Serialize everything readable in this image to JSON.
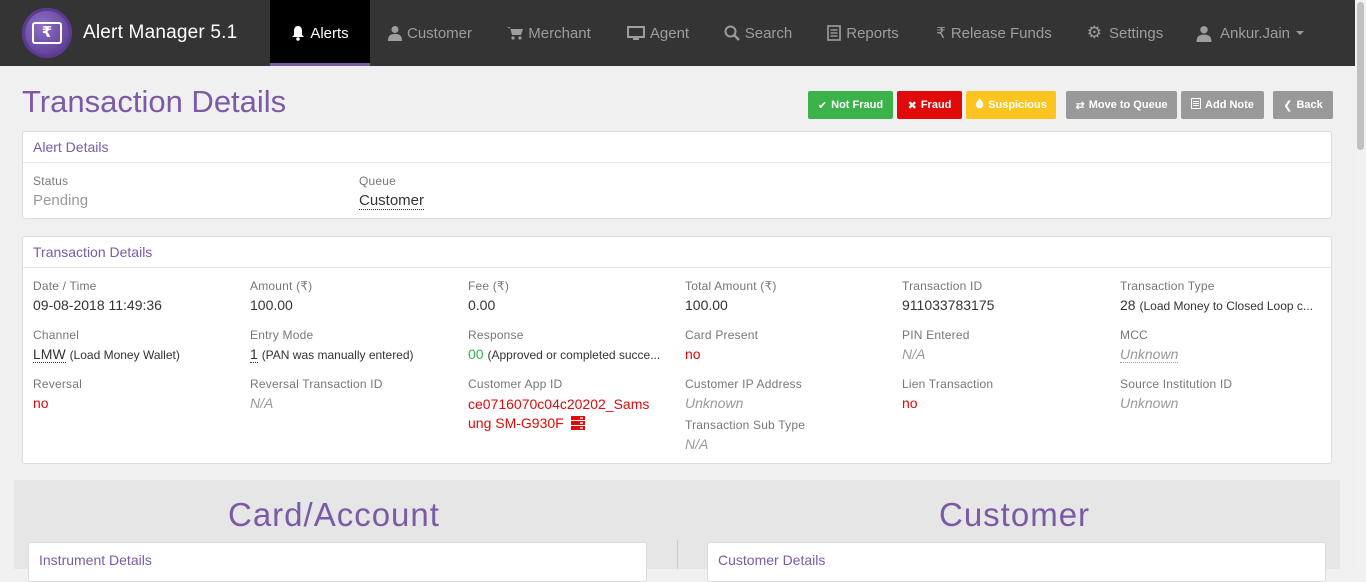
{
  "app": {
    "title": "Alert Manager 5.1",
    "logo_symbol": "₹"
  },
  "nav": {
    "items": [
      {
        "label": "Alerts",
        "icon": "bell-icon",
        "active": true
      },
      {
        "label": "Customer",
        "icon": "user-icon"
      },
      {
        "label": "Merchant",
        "icon": "cart-icon"
      },
      {
        "label": "Agent",
        "icon": "monitor-icon"
      },
      {
        "label": "Search",
        "icon": "search-icon"
      },
      {
        "label": "Reports",
        "icon": "list-icon"
      },
      {
        "label": "Release Funds",
        "icon": "rupee-icon"
      },
      {
        "label": "Settings",
        "icon": "gear-icon"
      }
    ],
    "user": "Ankur.Jain"
  },
  "page": {
    "title": "Transaction Details"
  },
  "actions": {
    "not_fraud": "Not Fraud",
    "fraud": "Fraud",
    "suspicious": "Suspicious",
    "move_to_queue": "Move to Queue",
    "add_note": "Add Note",
    "back": "Back"
  },
  "alert_details": {
    "heading": "Alert Details",
    "status_label": "Status",
    "status_value": "Pending",
    "queue_label": "Queue",
    "queue_value": "Customer"
  },
  "transaction_details": {
    "heading": "Transaction Details",
    "date_time": {
      "label": "Date / Time",
      "value": "09-08-2018 11:49:36"
    },
    "amount": {
      "label": "Amount (₹)",
      "value": "100.00"
    },
    "fee": {
      "label": "Fee (₹)",
      "value": "0.00"
    },
    "total_amount": {
      "label": "Total Amount (₹)",
      "value": "100.00"
    },
    "transaction_id": {
      "label": "Transaction ID",
      "value": "911033783175"
    },
    "transaction_type": {
      "label": "Transaction Type",
      "code": "28",
      "desc": "(Load Money to Closed Loop c..."
    },
    "channel": {
      "label": "Channel",
      "code": "LMW",
      "desc": "(Load Money Wallet)"
    },
    "entry_mode": {
      "label": "Entry Mode",
      "code": "1",
      "desc": "(PAN was manually entered)"
    },
    "response": {
      "label": "Response",
      "code": "00",
      "desc": "(Approved or completed succe..."
    },
    "card_present": {
      "label": "Card Present",
      "value": "no"
    },
    "pin_entered": {
      "label": "PIN Entered",
      "value": "N/A"
    },
    "mcc": {
      "label": "MCC",
      "value": "Unknown"
    },
    "reversal": {
      "label": "Reversal",
      "value": "no"
    },
    "reversal_txn_id": {
      "label": "Reversal Transaction ID",
      "value": "N/A"
    },
    "customer_app_id": {
      "label": "Customer App ID",
      "value_line1": "ce0716070c04c20202_Sams",
      "value_line2": "ung SM-G930F"
    },
    "customer_ip": {
      "label": "Customer IP Address",
      "value": "Unknown"
    },
    "txn_sub_type": {
      "label": "Transaction Sub Type",
      "value": "N/A"
    },
    "lien_transaction": {
      "label": "Lien Transaction",
      "value": "no"
    },
    "source_institution": {
      "label": "Source Institution ID",
      "value": "Unknown"
    }
  },
  "sections": {
    "card_account": "Card/Account",
    "customer": "Customer",
    "instrument_details": "Instrument Details",
    "customer_details": "Customer Details"
  },
  "colors": {
    "brand": "#7b5aa6",
    "navbar": "#343434",
    "green": "#3bb34a",
    "red": "#e00a0a",
    "yellow": "#fcc41e",
    "gray": "#999999"
  }
}
